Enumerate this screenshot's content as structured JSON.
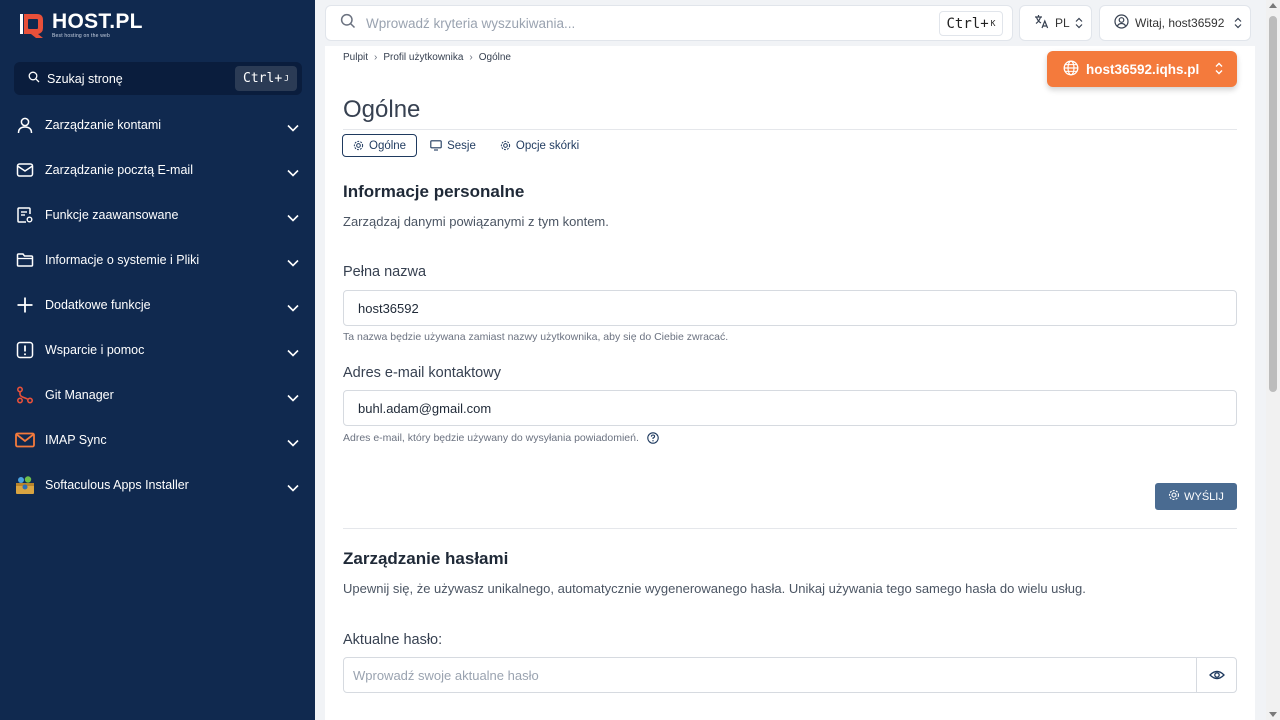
{
  "brand": {
    "name": "HOST.PL",
    "tagline": "Best hosting on the web"
  },
  "sidebar": {
    "search_label": "Szukaj stronę",
    "search_shortcut": "Ctrl+",
    "search_shortcut_key": "J",
    "items": [
      {
        "label": "Zarządzanie kontami",
        "icon": "user-icon"
      },
      {
        "label": "Zarządzanie pocztą E-mail",
        "icon": "mail-icon"
      },
      {
        "label": "Funkcje zaawansowane",
        "icon": "advanced-settings-icon"
      },
      {
        "label": "Informacje o systemie i Pliki",
        "icon": "folder-icon"
      },
      {
        "label": "Dodatkowe funkcje",
        "icon": "plus-icon"
      },
      {
        "label": "Wsparcie i pomoc",
        "icon": "alert-icon"
      },
      {
        "label": "Git Manager",
        "icon": "git-icon"
      },
      {
        "label": "IMAP Sync",
        "icon": "imap-mail-icon"
      },
      {
        "label": "Softaculous Apps Installer",
        "icon": "softaculous-icon"
      }
    ]
  },
  "topbar": {
    "search_placeholder": "Wprowadź kryteria wyszukiwania...",
    "search_shortcut": "Ctrl+",
    "search_shortcut_key": "K",
    "language": "PL",
    "user_greeting": "Witaj, host36592"
  },
  "breadcrumb": [
    "Pulpit",
    "Profil użytkownika",
    "Ogólne"
  ],
  "domain_selector": "host36592.iqhs.pl",
  "page": {
    "title": "Ogólne",
    "tabs": [
      {
        "label": "Ogólne",
        "icon": "gear-icon",
        "active": true
      },
      {
        "label": "Sesje",
        "icon": "monitor-icon",
        "active": false
      },
      {
        "label": "Opcje skórki",
        "icon": "gear-icon",
        "active": false
      }
    ]
  },
  "personal": {
    "title": "Informacje personalne",
    "description": "Zarządzaj danymi powiązanymi z tym kontem.",
    "fullname_label": "Pełna nazwa",
    "fullname_value": "host36592",
    "fullname_help": "Ta nazwa będzie używana zamiast nazwy użytkownika, aby się do Ciebie zwracać.",
    "email_label": "Adres e-mail kontaktowy",
    "email_value": "buhl.adam@gmail.com",
    "email_help": "Adres e-mail, który będzie używany do wysyłania powiadomień.",
    "submit_label": "WYŚLIJ"
  },
  "passwords": {
    "title": "Zarządzanie hasłami",
    "description": "Upewnij się, że używasz unikalnego, automatycznie wygenerowanego hasła. Unikaj używania tego samego hasła do wielu usług.",
    "current_label": "Aktualne hasło:",
    "current_placeholder": "Wprowadź swoje aktualne hasło"
  },
  "colors": {
    "sidebar_bg": "#10294f",
    "accent_orange": "#f47a3c",
    "button_blue": "#4a6b91",
    "icon_red": "#e8503a"
  }
}
